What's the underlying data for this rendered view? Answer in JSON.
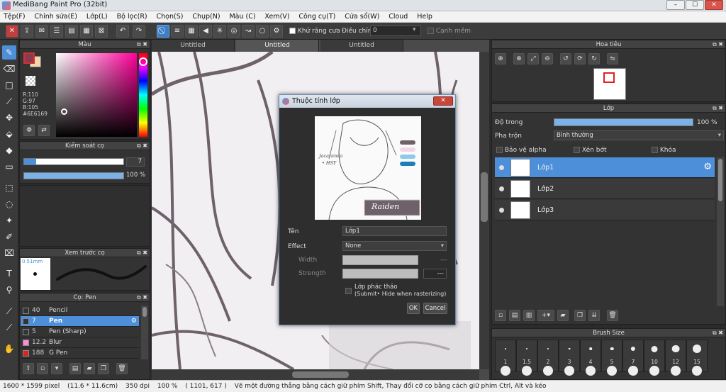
{
  "window": {
    "title": "MediBang Paint Pro (32bit)",
    "min": "–",
    "max": "☐",
    "close": "✕"
  },
  "menu": [
    "Tệp(F)",
    "Chỉnh sửa(E)",
    "Lớp(L)",
    "Bộ lọc(R)",
    "Chọn(S)",
    "Chụp(N)",
    "Màu (C)",
    "Xem(V)",
    "Công cụ(T)",
    "Cửa sổ(W)",
    "Cloud",
    "Help"
  ],
  "toolbar": {
    "antialias": "Khử răng cưa",
    "adjust": "Điều chỉnh",
    "adjust_value": "0",
    "sharp": "Cạnh mềm"
  },
  "color_panel": {
    "title": "Màu",
    "r": "R:110",
    "g": "G:97",
    "b": "B:105",
    "hex": "#6E6169",
    "primary": "#6e6169"
  },
  "brush_control": {
    "title": "Kiểm soát cọ",
    "size": "7",
    "opacity": "100 %",
    "opacity_value": 1.0
  },
  "brush_preview": {
    "title": "Xem trước cọ",
    "size": "0.51mm"
  },
  "pen_panel": {
    "title": "Cọ: Pen",
    "items": [
      {
        "size": "40",
        "name": "Pencil",
        "color": "#333333"
      },
      {
        "size": "7",
        "name": "Pen",
        "color": "#333333"
      },
      {
        "size": "5",
        "name": "Pen (Sharp)",
        "color": "#333333"
      },
      {
        "size": "12.2",
        "name": "Blur",
        "color": "#ff8ad8"
      },
      {
        "size": "188",
        "name": "G Pen",
        "color": "#e02020"
      }
    ]
  },
  "doc_tabs": [
    "Untitled",
    "Untitled",
    "Untitled"
  ],
  "dialog": {
    "title": "Thuộc tính lớp",
    "name_label": "Tên",
    "name_value": "Lớp1",
    "effect_label": "Effect",
    "effect_value": "None",
    "width_label": "Width",
    "strength_label": "Strength",
    "strength_value": "---",
    "draft_label": "Lớp phác thảo",
    "draft_hint": "(Submit• Hide when rasterizing)",
    "ok": "OK",
    "cancel": "Cancel",
    "thumb_sign": "Raiden",
    "thumb_text1": "Jacaranda",
    "thumb_text2": "• HSY"
  },
  "navigator": {
    "title": "Hoa tiêu"
  },
  "layer_panel": {
    "title": "Lớp",
    "opacity_label": "Độ trong",
    "opacity_value": "100 %",
    "opacity_fraction": 1.0,
    "blend_label": "Pha trộn",
    "blend_value": "Bình thường",
    "protect_alpha": "Bảo vệ alpha",
    "clipping": "Xén bớt",
    "lock": "Khóa",
    "layers": [
      "Lớp1",
      "Lớp2",
      "Lớp3"
    ]
  },
  "brush_size": {
    "title": "Brush Size",
    "sizes": [
      "1",
      "1.5",
      "2",
      "3",
      "4",
      "5",
      "7",
      "10",
      "12",
      "15"
    ]
  },
  "status": {
    "size": "1600 * 1599 pixel",
    "cm": "(11.6 * 11.6cm)",
    "dpi": "350 dpi",
    "zoom": "100 %",
    "coords": "( 1101, 617 )",
    "hint": "Vẽ một đường thẳng bằng cách giữ phím Shift, Thay đổi cỡ cọ bằng cách giữ phím Ctrl, Alt và kéo"
  },
  "colors": {
    "accent": "#4d8fd8",
    "panel": "#333333",
    "swatch_pink": "#8b3a50",
    "swatch_peach": "#f5d6a8"
  }
}
